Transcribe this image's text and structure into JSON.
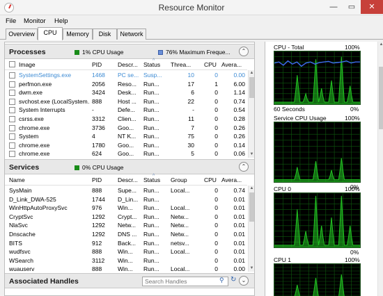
{
  "window": {
    "title": "Resource Monitor",
    "min": "—",
    "max": "▭",
    "close": "✕"
  },
  "menu": [
    "File",
    "Monitor",
    "Help"
  ],
  "tabs": [
    "Overview",
    "CPU",
    "Memory",
    "Disk",
    "Network"
  ],
  "processes": {
    "title": "Processes",
    "cpu_usage": "1% CPU Usage",
    "max_freq": "76% Maximum Freque...",
    "columns": [
      "Image",
      "PID",
      "Descr...",
      "Status",
      "Threa...",
      "CPU",
      "Avera..."
    ],
    "rows": [
      {
        "image": "SystemSettings.exe",
        "pid": "1468",
        "desc": "PC se...",
        "status": "Susp...",
        "threads": "10",
        "cpu": "0",
        "avg": "0.00",
        "suspended": true
      },
      {
        "image": "perfmon.exe",
        "pid": "2056",
        "desc": "Reso...",
        "status": "Run...",
        "threads": "17",
        "cpu": "1",
        "avg": "6.00"
      },
      {
        "image": "dwm.exe",
        "pid": "3424",
        "desc": "Desk...",
        "status": "Run...",
        "threads": "6",
        "cpu": "0",
        "avg": "1.14"
      },
      {
        "image": "svchost.exe (LocalSystem...",
        "pid": "888",
        "desc": "Host ...",
        "status": "Run...",
        "threads": "22",
        "cpu": "0",
        "avg": "0.74"
      },
      {
        "image": "System Interrupts",
        "pid": "-",
        "desc": "Defe...",
        "status": "Run...",
        "threads": "-",
        "cpu": "0",
        "avg": "0.54"
      },
      {
        "image": "csrss.exe",
        "pid": "3312",
        "desc": "Clien...",
        "status": "Run...",
        "threads": "11",
        "cpu": "0",
        "avg": "0.28"
      },
      {
        "image": "chrome.exe",
        "pid": "3736",
        "desc": "Goo...",
        "status": "Run...",
        "threads": "7",
        "cpu": "0",
        "avg": "0.26"
      },
      {
        "image": "System",
        "pid": "4",
        "desc": "NT K...",
        "status": "Run...",
        "threads": "75",
        "cpu": "0",
        "avg": "0.26"
      },
      {
        "image": "chrome.exe",
        "pid": "1780",
        "desc": "Goo...",
        "status": "Run...",
        "threads": "30",
        "cpu": "0",
        "avg": "0.14"
      },
      {
        "image": "chrome.exe",
        "pid": "624",
        "desc": "Goo...",
        "status": "Run...",
        "threads": "5",
        "cpu": "0",
        "avg": "0.06"
      }
    ]
  },
  "services": {
    "title": "Services",
    "cpu_usage": "0% CPU Usage",
    "columns": [
      "Name",
      "PID",
      "Descr...",
      "Status",
      "Group",
      "CPU",
      "Avera..."
    ],
    "rows": [
      {
        "name": "SysMain",
        "pid": "888",
        "desc": "Supe...",
        "status": "Run...",
        "group": "Local...",
        "cpu": "0",
        "avg": "0.74"
      },
      {
        "name": "D_Link_DWA-525",
        "pid": "1744",
        "desc": "D_Lin...",
        "status": "Run...",
        "group": "",
        "cpu": "0",
        "avg": "0.01"
      },
      {
        "name": "WinHttpAutoProxySvc",
        "pid": "976",
        "desc": "Win...",
        "status": "Run...",
        "group": "Local...",
        "cpu": "0",
        "avg": "0.01"
      },
      {
        "name": "CryptSvc",
        "pid": "1292",
        "desc": "Crypt...",
        "status": "Run...",
        "group": "Netw...",
        "cpu": "0",
        "avg": "0.01"
      },
      {
        "name": "NlaSvc",
        "pid": "1292",
        "desc": "Netw...",
        "status": "Run...",
        "group": "Netw...",
        "cpu": "0",
        "avg": "0.01"
      },
      {
        "name": "Dnscache",
        "pid": "1292",
        "desc": "DNS ...",
        "status": "Run...",
        "group": "Netw...",
        "cpu": "0",
        "avg": "0.01"
      },
      {
        "name": "BITS",
        "pid": "912",
        "desc": "Back...",
        "status": "Run...",
        "group": "netsv...",
        "cpu": "0",
        "avg": "0.01"
      },
      {
        "name": "wudfsvc",
        "pid": "888",
        "desc": "Win...",
        "status": "Run...",
        "group": "Local...",
        "cpu": "0",
        "avg": "0.01"
      },
      {
        "name": "WSearch",
        "pid": "3112",
        "desc": "Win...",
        "status": "Run...",
        "group": "",
        "cpu": "0",
        "avg": "0.01"
      },
      {
        "name": "wuauserv",
        "pid": "888",
        "desc": "Win...",
        "status": "Run...",
        "group": "Local...",
        "cpu": "0",
        "avg": "0.00"
      }
    ]
  },
  "handles": {
    "title": "Associated Handles",
    "search_placeholder": "Search Handles"
  },
  "graphs": {
    "total": {
      "title": "CPU - Total",
      "max": "100%",
      "min": "0%",
      "time": "60 Seconds"
    },
    "service": {
      "title": "Service CPU Usage",
      "max": "100%",
      "min": "0%"
    },
    "cpu0": {
      "title": "CPU 0",
      "max": "100%",
      "min": "0%"
    },
    "cpu1": {
      "title": "CPU 1",
      "max": "100%"
    }
  },
  "colors": {
    "graph_green": "#22c422",
    "graph_blue": "#3d6cf0",
    "grid": "#0e5a0e"
  }
}
